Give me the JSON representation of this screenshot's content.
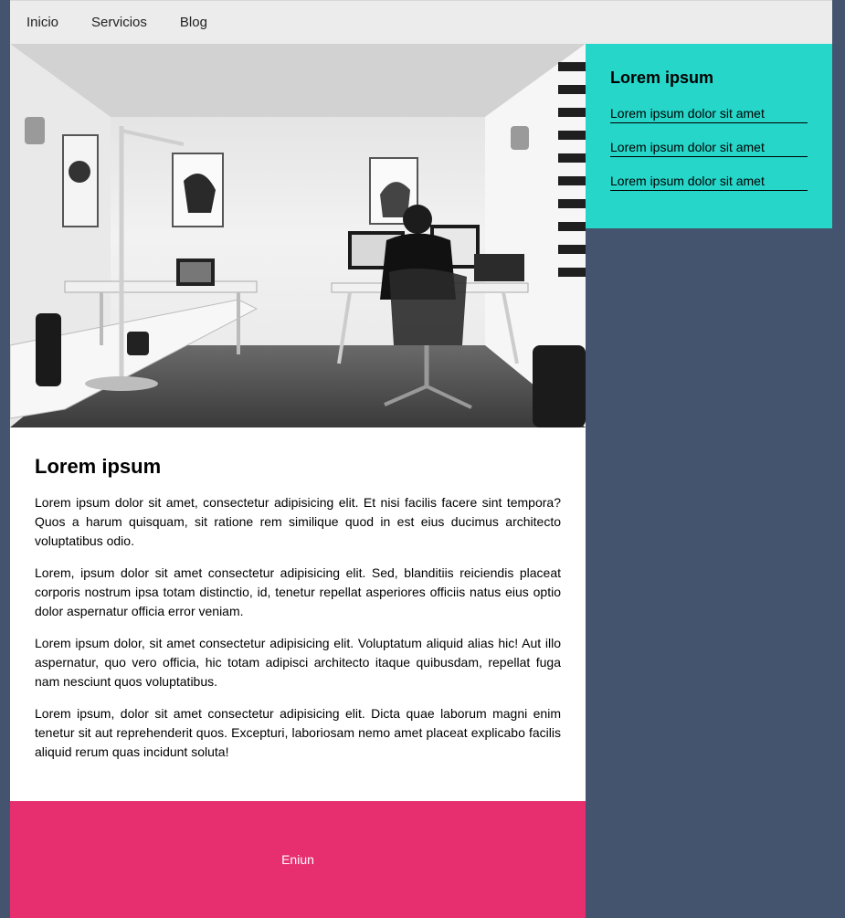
{
  "nav": {
    "items": [
      "Inicio",
      "Servicios",
      "Blog"
    ]
  },
  "main": {
    "title": "Lorem ipsum",
    "paragraphs": [
      "Lorem ipsum dolor sit amet, consectetur adipisicing elit. Et nisi facilis facere sint tempora? Quos a harum quisquam, sit ratione rem similique quod in est eius ducimus architecto voluptatibus odio.",
      "Lorem, ipsum dolor sit amet consectetur adipisicing elit. Sed, blanditiis reiciendis placeat corporis nostrum ipsa totam distinctio, id, tenetur repellat asperiores officiis natus eius optio dolor aspernatur officia error veniam.",
      "Lorem ipsum dolor, sit amet consectetur adipisicing elit. Voluptatum aliquid alias hic! Aut illo aspernatur, quo vero officia, hic totam adipisci architecto itaque quibusdam, repellat fuga nam nesciunt quos voluptatibus.",
      "Lorem ipsum, dolor sit amet consectetur adipisicing elit. Dicta quae laborum magni enim tenetur sit aut reprehenderit quos. Excepturi, laboriosam nemo amet placeat explicabo facilis aliquid rerum quas incidunt soluta!"
    ]
  },
  "aside": {
    "title": "Lorem ipsum",
    "links": [
      "Lorem ipsum dolor sit amet",
      "Lorem ipsum dolor sit amet",
      "Lorem ipsum dolor sit amet"
    ]
  },
  "footer": {
    "text": "Eniun"
  },
  "colors": {
    "background": "#44546e",
    "nav": "#ececec",
    "aside": "#25d6c9",
    "footer": "#e72e6e"
  }
}
